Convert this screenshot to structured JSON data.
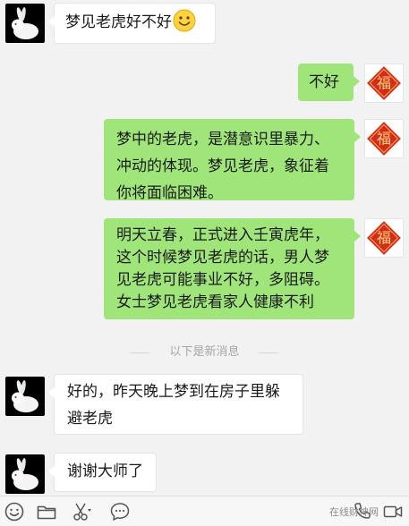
{
  "messages": [
    {
      "id": "m1",
      "from": "contact",
      "text": "梦见老虎好不好"
    },
    {
      "id": "m2",
      "from": "me",
      "text": "不好"
    },
    {
      "id": "m3",
      "from": "me",
      "lines": [
        "梦中的老虎，是潜意识里暴力、",
        "冲动的体现。梦见老虎，象征着",
        "你将面临困难。"
      ]
    },
    {
      "id": "m4",
      "from": "me",
      "lines": [
        "明天立春，正式进入壬寅虎年，",
        "这个时候梦见老虎的话，男人梦",
        "见老虎可能事业不好，多阻碍。",
        "女士梦见老虎看家人健康不利"
      ]
    },
    {
      "id": "m5",
      "from": "contact",
      "lines": [
        "好的，昨天晚上梦到在房子里躲",
        "避老虎"
      ]
    },
    {
      "id": "m6",
      "from": "contact",
      "text": "谢谢大师了"
    }
  ],
  "divider_text": "以下是新消息",
  "avatars": {
    "contact": "rabbit-avatar",
    "me": "fu-avatar",
    "fu_char": "福"
  },
  "toolbar": {
    "icons": [
      "emoji-icon",
      "folder-icon",
      "scissors-icon",
      "chat-bubble-icon",
      "phone-icon",
      "video-icon"
    ],
    "watermark": "在线财神网"
  },
  "colors": {
    "bubble_me": "#9fe57a",
    "bubble_contact": "#ffffff",
    "background": "#f2f2f2",
    "fu_red": "#d62b1c",
    "fu_gold": "#e9b94a"
  }
}
